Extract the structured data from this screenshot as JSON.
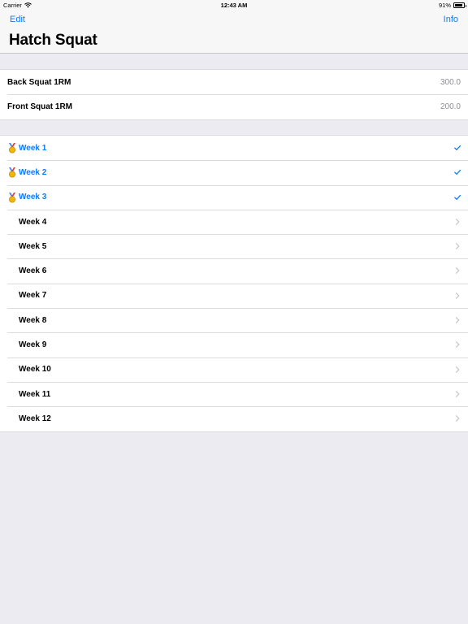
{
  "status_bar": {
    "carrier": "Carrier",
    "time": "12:43 AM",
    "battery": "91%",
    "battery_level": 0.91
  },
  "nav": {
    "edit_label": "Edit",
    "info_label": "Info",
    "title": "Hatch Squat",
    "accent_color": "#0a7aff"
  },
  "one_rm": [
    {
      "label": "Back Squat 1RM",
      "value": "300.0"
    },
    {
      "label": "Front Squat 1RM",
      "value": "200.0"
    }
  ],
  "weeks": [
    {
      "label": "Week 1",
      "completed": true,
      "icon": "medal-icon"
    },
    {
      "label": "Week 2",
      "completed": true,
      "icon": "medal-icon"
    },
    {
      "label": "Week 3",
      "completed": true,
      "icon": "medal-icon"
    },
    {
      "label": "Week 4",
      "completed": false
    },
    {
      "label": "Week 5",
      "completed": false
    },
    {
      "label": "Week 6",
      "completed": false
    },
    {
      "label": "Week 7",
      "completed": false
    },
    {
      "label": "Week 8",
      "completed": false
    },
    {
      "label": "Week 9",
      "completed": false
    },
    {
      "label": "Week 10",
      "completed": false
    },
    {
      "label": "Week 11",
      "completed": false
    },
    {
      "label": "Week 12",
      "completed": false
    }
  ]
}
